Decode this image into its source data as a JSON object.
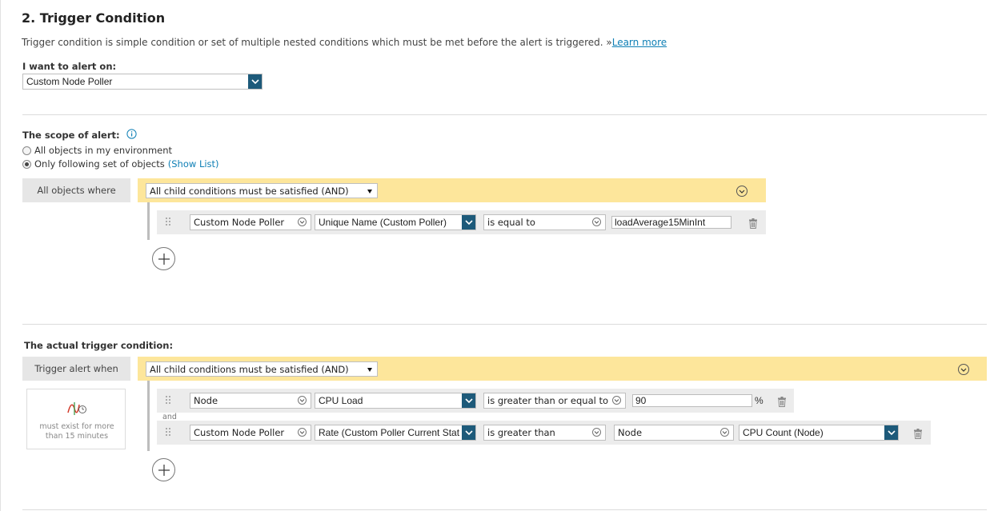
{
  "section": {
    "title": "2. Trigger Condition",
    "description": "Trigger condition is simple condition or set of multiple nested conditions which must be met before the alert is triggered. »",
    "learn_more": "Learn more"
  },
  "alert_on": {
    "label": "I want to alert on:",
    "value": "Custom Node Poller"
  },
  "scope": {
    "label": "The scope of alert:",
    "options": [
      {
        "label": "All objects in my environment",
        "selected": false
      },
      {
        "label": "Only following set of objects",
        "selected": true
      }
    ],
    "show_list": "(Show List)",
    "group_label": "All objects where",
    "group_operator": "All child conditions must be satisfied (AND)",
    "condition": {
      "object": "Custom Node Poller",
      "field": "Unique Name (Custom Poller)",
      "operator": "is equal to",
      "value": "loadAverage15MinInt"
    }
  },
  "trigger": {
    "label": "The actual trigger condition:",
    "group_label": "Trigger alert when",
    "group_operator": "All child conditions must be satisfied (AND)",
    "time_note": "must exist for more than 15 minutes",
    "and_label": "and",
    "conditions": [
      {
        "object": "Node",
        "field": "CPU Load",
        "operator": "is greater than or equal to",
        "value": "90",
        "unit": "%"
      },
      {
        "object": "Custom Node Poller",
        "field": "Rate (Custom Poller Current Stat",
        "operator": "is greater than",
        "compare_object": "Node",
        "compare_field": "CPU Count (Node)"
      }
    ]
  },
  "colors": {
    "yellow_bar": "#fde69b",
    "select_arrow": "#1d5a7a",
    "link": "#0e7fb5",
    "time_icon": "#d23a2a"
  },
  "icons": [
    "info-icon",
    "drag-handle-icon",
    "trash-icon",
    "add-icon",
    "collapse-icon",
    "time-condition-icon"
  ]
}
